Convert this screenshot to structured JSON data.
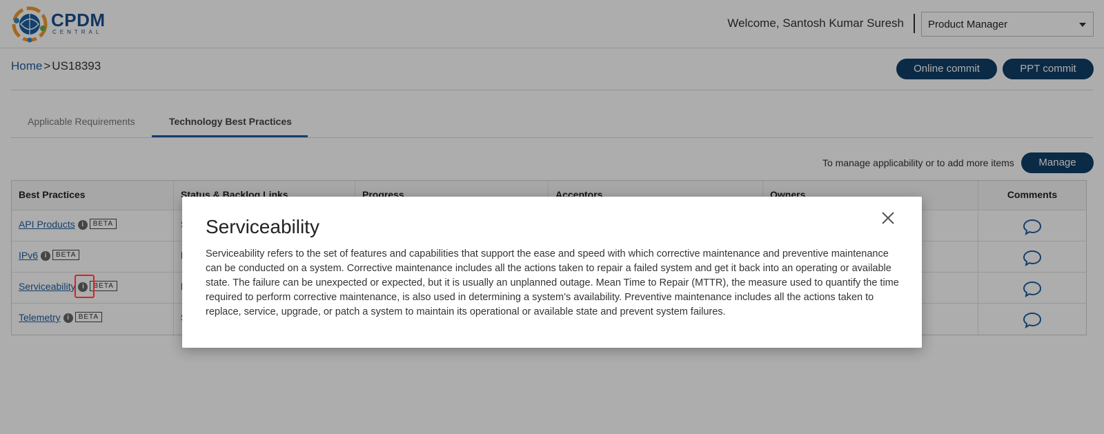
{
  "header": {
    "logo_text": "CPDM",
    "logo_sub": "CENTRAL",
    "welcome": "Welcome, Santosh Kumar Suresh",
    "role_select": "Product Manager"
  },
  "breadcrumb": {
    "home": "Home",
    "chevron": ">",
    "current": "US18393"
  },
  "actions": {
    "online_commit": "Online commit",
    "ppt_commit": "PPT commit"
  },
  "tabs": [
    {
      "label": "Applicable Requirements"
    },
    {
      "label": "Technology Best Practices"
    }
  ],
  "manage": {
    "text": "To manage applicability or to add more items",
    "button": "Manage"
  },
  "table": {
    "headers": [
      "Best Practices",
      "Status & Backlog Links",
      "Progress",
      "Acceptors",
      "Owners",
      "Comments"
    ],
    "rows": [
      {
        "name": "API Products",
        "badge": "BETA",
        "status": "S"
      },
      {
        "name": "IPv6",
        "badge": "BETA",
        "status": "N"
      },
      {
        "name": "Serviceability",
        "badge": "BETA",
        "status": "N"
      },
      {
        "name": "Telemetry",
        "badge": "BETA",
        "status": "S"
      }
    ]
  },
  "modal": {
    "title": "Serviceability",
    "body": "Serviceability refers to the set of features and capabilities that support the ease and speed with which corrective maintenance and preventive maintenance can be conducted on a system. Corrective maintenance includes all the actions taken to repair a failed system and get it back into an operating or available state. The failure can be unexpected or expected, but it is usually an unplanned outage. Mean Time to Repair (MTTR), the measure used to quantify the time required to perform corrective maintenance, is also used in determining a system’s availability. Preventive maintenance includes all the actions taken to replace, service, upgrade, or patch a system to maintain its operational or available state and prevent system failures."
  },
  "icons": {
    "info": "info-icon",
    "comment": "comment-icon",
    "close": "close-icon",
    "dropdown": "chevron-down-icon"
  },
  "colors": {
    "accent": "#0f3e68",
    "link": "#1d5e9e",
    "comment": "#1d5e9e"
  }
}
